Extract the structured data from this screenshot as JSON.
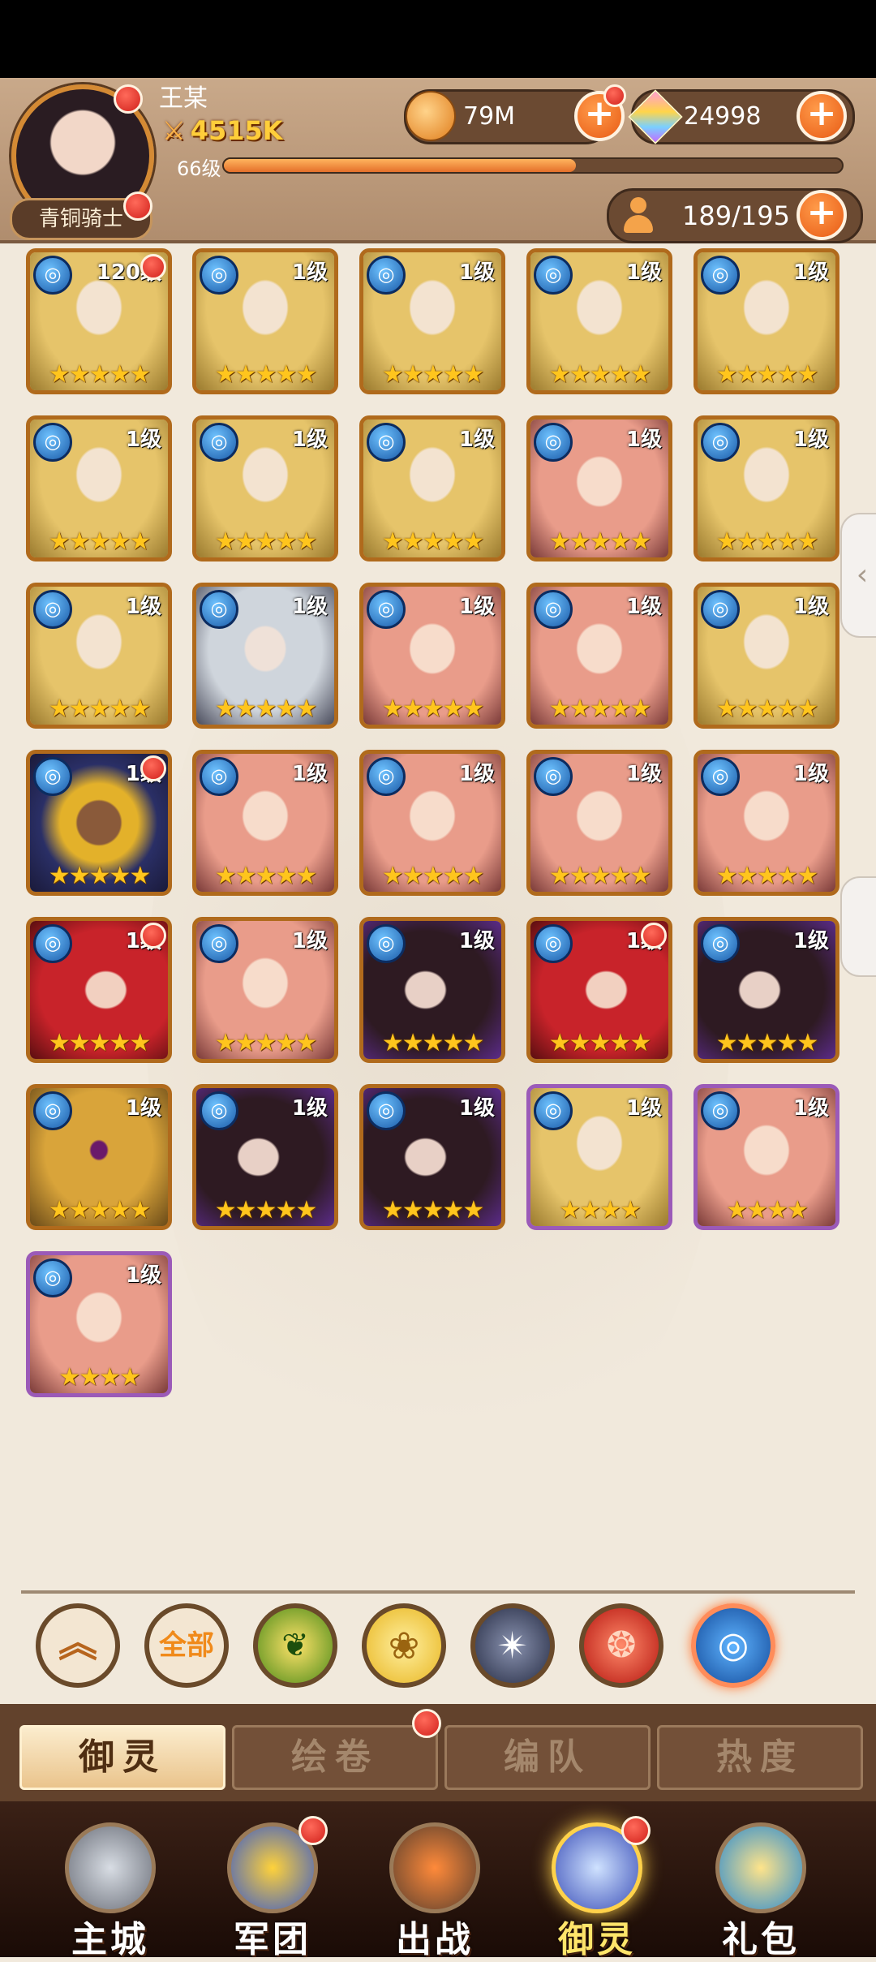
{
  "player": {
    "name": "王某",
    "rank_title": "青铜骑士",
    "power": "4515K",
    "level_label": "66级",
    "xp_progress": 0.57
  },
  "resources": {
    "gold": "79M",
    "gems": "24998",
    "capacity": "189/195"
  },
  "icons": {
    "plus": "+",
    "swords": "⚔",
    "chevron_left": "‹",
    "up": "︽",
    "star": "★"
  },
  "heroes": [
    {
      "level": "120级",
      "stars": "★★★★★",
      "rarity": "gold",
      "tone": "blonde",
      "badge": true
    },
    {
      "level": "1级",
      "stars": "★★★★★",
      "rarity": "gold",
      "tone": "blonde",
      "badge": false
    },
    {
      "level": "1级",
      "stars": "★★★★★",
      "rarity": "gold",
      "tone": "blonde",
      "badge": false
    },
    {
      "level": "1级",
      "stars": "★★★★★",
      "rarity": "gold",
      "tone": "blonde",
      "badge": false
    },
    {
      "level": "1级",
      "stars": "★★★★★",
      "rarity": "gold",
      "tone": "blonde",
      "badge": false
    },
    {
      "level": "1级",
      "stars": "★★★★★",
      "rarity": "gold",
      "tone": "blonde",
      "badge": false
    },
    {
      "level": "1级",
      "stars": "★★★★★",
      "rarity": "gold",
      "tone": "blonde",
      "badge": false
    },
    {
      "level": "1级",
      "stars": "★★★★★",
      "rarity": "gold",
      "tone": "blonde",
      "badge": false
    },
    {
      "level": "1级",
      "stars": "★★★★★",
      "rarity": "gold",
      "tone": "pink",
      "badge": false
    },
    {
      "level": "1级",
      "stars": "★★★★★",
      "rarity": "gold",
      "tone": "blonde",
      "badge": false
    },
    {
      "level": "1级",
      "stars": "★★★★★",
      "rarity": "gold",
      "tone": "blonde",
      "badge": false
    },
    {
      "level": "1级",
      "stars": "★★★★★",
      "rarity": "gold",
      "tone": "silver",
      "badge": false
    },
    {
      "level": "1级",
      "stars": "★★★★★",
      "rarity": "gold",
      "tone": "pink",
      "badge": false
    },
    {
      "level": "1级",
      "stars": "★★★★★",
      "rarity": "gold",
      "tone": "pink",
      "badge": false
    },
    {
      "level": "1级",
      "stars": "★★★★★",
      "rarity": "gold",
      "tone": "blonde",
      "badge": false
    },
    {
      "level": "1级",
      "stars": "★★★★★",
      "rarity": "gold",
      "tone": "dark",
      "badge": true
    },
    {
      "level": "1级",
      "stars": "★★★★★",
      "rarity": "gold",
      "tone": "pink",
      "badge": false
    },
    {
      "level": "1级",
      "stars": "★★★★★",
      "rarity": "gold",
      "tone": "pink",
      "badge": false
    },
    {
      "level": "1级",
      "stars": "★★★★★",
      "rarity": "gold",
      "tone": "pink",
      "badge": false
    },
    {
      "level": "1级",
      "stars": "★★★★★",
      "rarity": "gold",
      "tone": "pink",
      "badge": false
    },
    {
      "level": "1级",
      "stars": "★★★★★",
      "rarity": "gold",
      "tone": "red",
      "badge": true
    },
    {
      "level": "1级",
      "stars": "★★★★★",
      "rarity": "gold",
      "tone": "pink",
      "badge": false
    },
    {
      "level": "1级",
      "stars": "★★★★★",
      "rarity": "gold",
      "tone": "vampire",
      "badge": false
    },
    {
      "level": "1级",
      "stars": "★★★★★",
      "rarity": "gold",
      "tone": "red",
      "badge": true
    },
    {
      "level": "1级",
      "stars": "★★★★★",
      "rarity": "gold",
      "tone": "vampire",
      "badge": false
    },
    {
      "level": "1级",
      "stars": "★★★★★",
      "rarity": "gold",
      "tone": "golden",
      "badge": false
    },
    {
      "level": "1级",
      "stars": "★★★★★",
      "rarity": "gold",
      "tone": "vampire",
      "badge": false
    },
    {
      "level": "1级",
      "stars": "★★★★★",
      "rarity": "gold",
      "tone": "vampire",
      "badge": false
    },
    {
      "level": "1级",
      "stars": "★★★★",
      "rarity": "purple",
      "tone": "blonde",
      "badge": false
    },
    {
      "level": "1级",
      "stars": "★★★★",
      "rarity": "purple",
      "tone": "pink",
      "badge": false
    },
    {
      "level": "1级",
      "stars": "★★★★",
      "rarity": "purple",
      "tone": "pink",
      "badge": false
    }
  ],
  "filters": [
    {
      "label": "︽",
      "type": "up"
    },
    {
      "label": "全部",
      "type": "all"
    },
    {
      "label": "❦",
      "type": "nature"
    },
    {
      "label": "❀",
      "type": "light"
    },
    {
      "label": "✴",
      "type": "dark"
    },
    {
      "label": "❂",
      "type": "fire"
    },
    {
      "label": "◎",
      "type": "water"
    }
  ],
  "sub_tabs": [
    "御灵",
    "绘卷",
    "编队",
    "热度"
  ],
  "nav": [
    "主城",
    "军团",
    "出战",
    "御灵",
    "礼包"
  ]
}
